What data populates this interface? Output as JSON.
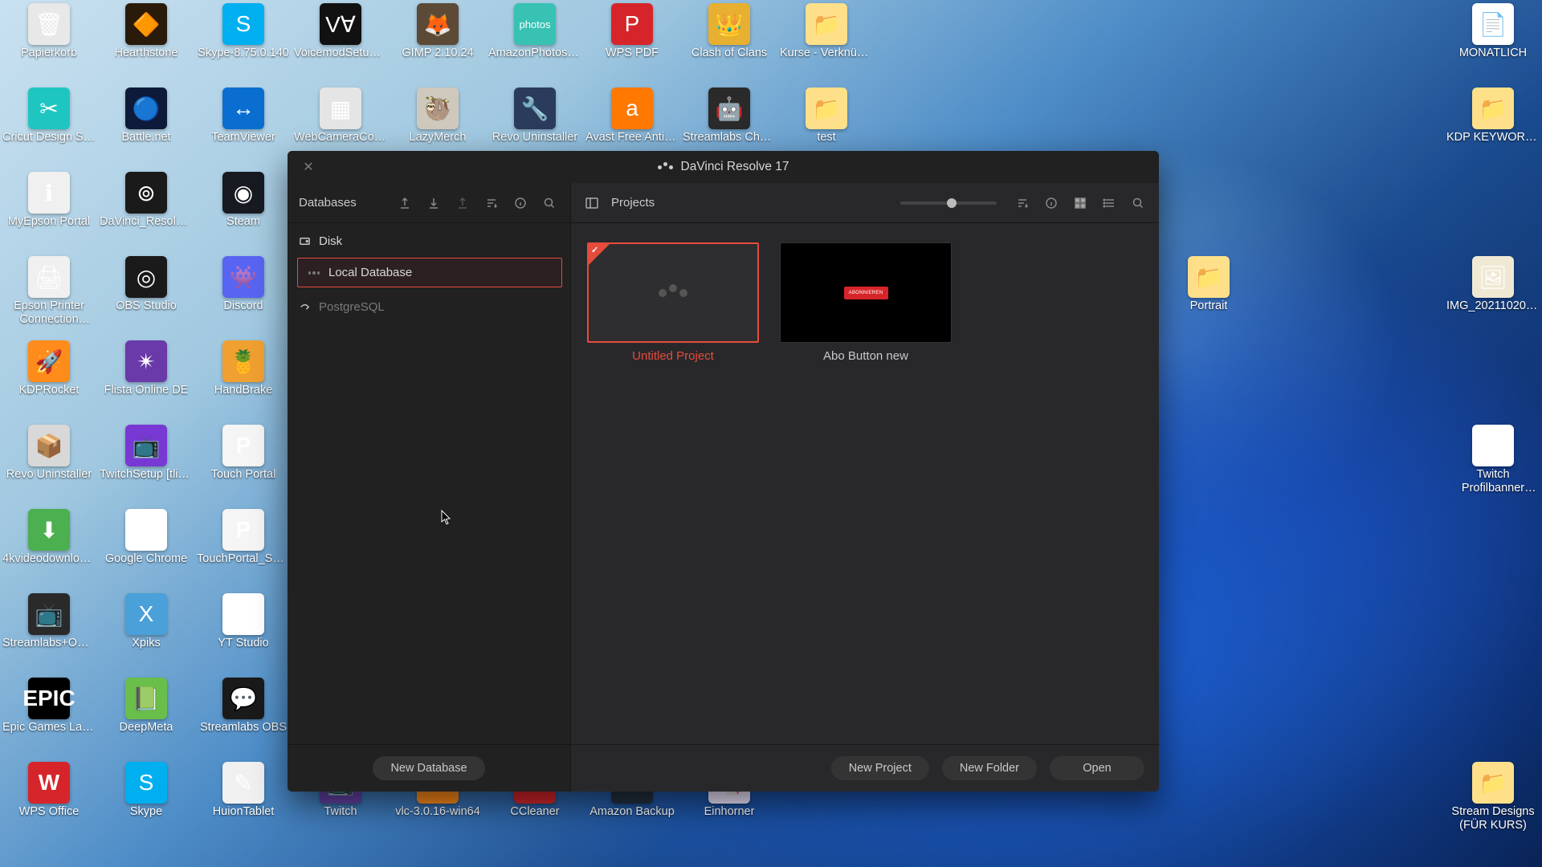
{
  "desktop_icons": {
    "row1": [
      "Papierkorb",
      "Hearthstone",
      "Skype-8.75.0.140",
      "VoicemodSetup_2.1...",
      "GIMP 2.10.24",
      "AmazonPhotosSetup",
      "WPS PDF",
      "Clash of Clans",
      "Kurse - Verknüpfung"
    ],
    "row2": [
      "Cricut Design Space",
      "Battle.net",
      "TeamViewer",
      "WebCameraConfig",
      "LazyMerch",
      "Revo Uninstaller",
      "Avast Free Antivirus",
      "Streamlabs Chatbot",
      "test"
    ],
    "row3": [
      "MyEpson Portal",
      "DaVinci_Resolve_16...",
      "Steam"
    ],
    "row4": [
      "Epson Printer Connection Checker",
      "OBS Studio",
      "Discord"
    ],
    "row5": [
      "KDPRocket",
      "Flista Online DE",
      "HandBrake"
    ],
    "row6": [
      "Revo Uninstaller",
      "TwitchSetup [tlisher...",
      "Touch Portal"
    ],
    "row7": [
      "4kvideodownloader...",
      "Google Chrome",
      "TouchPortal_Setup"
    ],
    "row8": [
      "Streamlabs+OBS+S...",
      "Xpiks",
      "YT Studio"
    ],
    "row9": [
      "Epic Games Launcher",
      "DeepMeta",
      "Streamlabs OBS"
    ],
    "row10": [
      "WPS Office",
      "Skype",
      "HuionTablet",
      "Twitch",
      "vlc-3.0.16-win64",
      "CCleaner",
      "Amazon Backup",
      "Einhorner"
    ],
    "right_col": [
      "MONATLICH",
      "KDP KEYWORDS",
      "Portrait",
      "IMG_20211020_114031",
      "Twitch Profilbanner template",
      "Stream Designs (FÜR KURS)"
    ]
  },
  "window": {
    "title": "DaVinci Resolve 17",
    "sidebar": {
      "header": "Databases",
      "disk_label": "Disk",
      "items": [
        {
          "name": "Local Database",
          "selected": true
        }
      ],
      "postgres_label": "PostgreSQL"
    },
    "main": {
      "header": "Projects"
    },
    "projects": [
      {
        "name": "Untitled Project",
        "selected": true,
        "has_flag": true,
        "thumb": "logo"
      },
      {
        "name": "Abo Button new",
        "selected": false,
        "has_flag": false,
        "thumb": "redbar"
      }
    ],
    "buttons": {
      "new_database": "New Database",
      "new_project": "New Project",
      "new_folder": "New Folder",
      "open": "Open"
    }
  }
}
